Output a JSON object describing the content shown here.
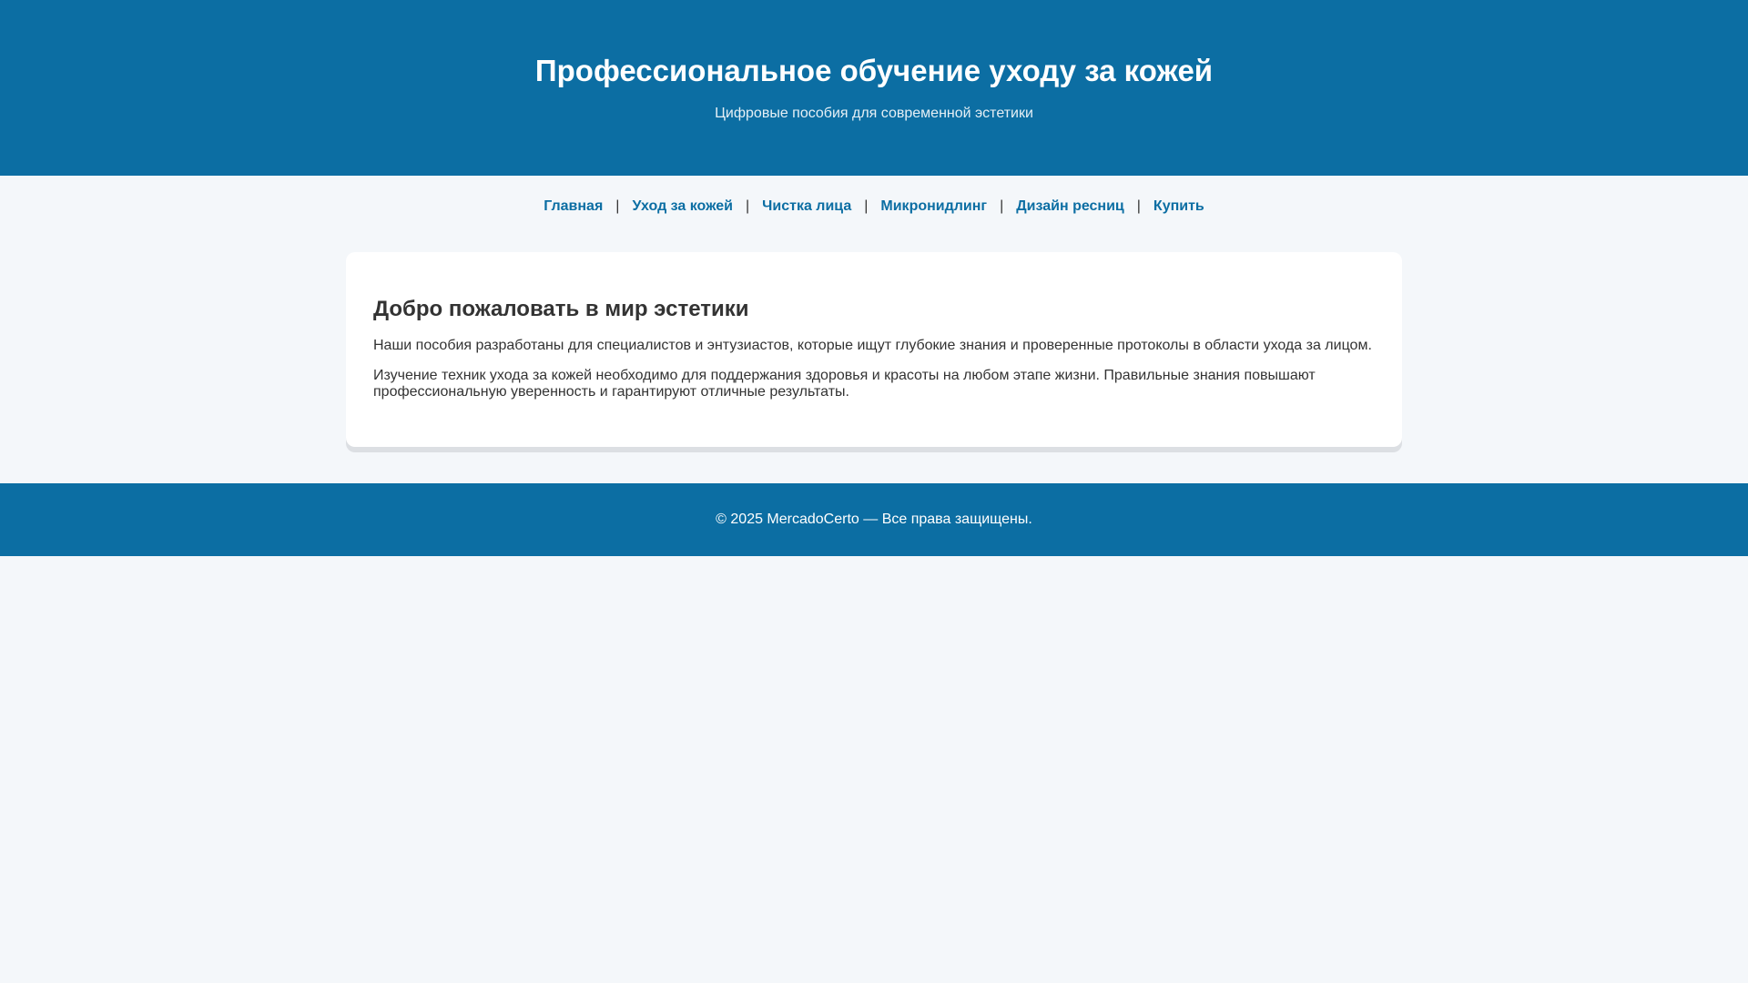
{
  "header": {
    "title": "Профессиональное обучение уходу за кожей",
    "subtitle": "Цифровые пособия для современной эстетики"
  },
  "nav": {
    "items": [
      "Главная",
      "Уход за кожей",
      "Чистка лица",
      "Микронидлинг",
      "Дизайн ресниц",
      "Купить"
    ],
    "separator": "|"
  },
  "main": {
    "heading": "Добро пожаловать в мир эстетики",
    "paragraphs": [
      "Наши пособия разработаны для специалистов и энтузиастов, которые ищут глубокие знания и проверенные протоколы в области ухода за лицом.",
      "Изучение техник ухода за кожей необходимо для поддержания здоровья и красоты на любом этапе жизни. Правильные знания повышают профессиональную уверенность и гарантируют отличные результаты."
    ]
  },
  "footer": {
    "text": "© 2025 MercadoCerto — Все права защищены."
  },
  "colors": {
    "primary": "#0c6ea3",
    "background": "#f4f7fa"
  }
}
